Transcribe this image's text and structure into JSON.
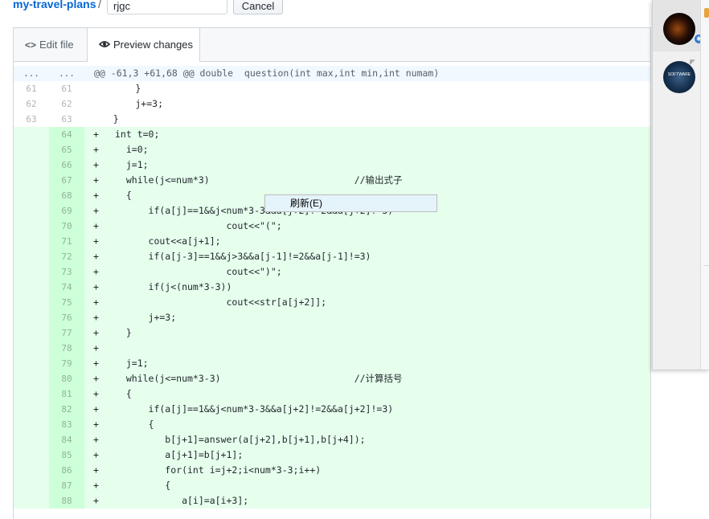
{
  "breadcrumb": {
    "repo": "my-travel-plans",
    "separator": "/",
    "filename": "rjgc",
    "cancel_label": "Cancel"
  },
  "tabs": [
    {
      "label": "Edit file",
      "icon": "code-icon",
      "active": false
    },
    {
      "label": "Preview changes",
      "icon": "eye-icon",
      "active": true
    }
  ],
  "diff": {
    "hunk": {
      "left": "...",
      "right": "...",
      "header": "@@ -61,3 +61,68 @@ double  question(int max,int min,int numam)"
    },
    "context_lines": [
      {
        "old": "61",
        "new": "61",
        "code": "        }"
      },
      {
        "old": "62",
        "new": "62",
        "code": "        j+=3;"
      },
      {
        "old": "63",
        "new": "63",
        "code": "    }"
      }
    ],
    "added_lines": [
      {
        "new": "64",
        "code": "int t=0;"
      },
      {
        "new": "65",
        "code": "  i=0;"
      },
      {
        "new": "66",
        "code": "  j=1;"
      },
      {
        "new": "67",
        "code": "  while(j<=num*3)                          //输出式子"
      },
      {
        "new": "68",
        "code": "  {"
      },
      {
        "new": "69",
        "code": "      if(a[j]==1&&j<num*3-3&&a[j+2]!=2&&a[j+2]!=3)"
      },
      {
        "new": "70",
        "code": "                    cout<<\"(\";"
      },
      {
        "new": "71",
        "code": "      cout<<a[j+1];"
      },
      {
        "new": "72",
        "code": "      if(a[j-3]==1&&j>3&&a[j-1]!=2&&a[j-1]!=3)"
      },
      {
        "new": "73",
        "code": "                    cout<<\")\";"
      },
      {
        "new": "74",
        "code": "      if(j<(num*3-3))"
      },
      {
        "new": "75",
        "code": "                    cout<<str[a[j+2]];"
      },
      {
        "new": "76",
        "code": "      j+=3;"
      },
      {
        "new": "77",
        "code": "  }"
      },
      {
        "new": "78",
        "code": ""
      },
      {
        "new": "79",
        "code": "  j=1;"
      },
      {
        "new": "80",
        "code": "  while(j<=num*3-3)                        //计算括号"
      },
      {
        "new": "81",
        "code": "  {"
      },
      {
        "new": "82",
        "code": "      if(a[j]==1&&j<num*3-3&&a[j+2]!=2&&a[j+2]!=3)"
      },
      {
        "new": "83",
        "code": "      {"
      },
      {
        "new": "84",
        "code": "         b[j+1]=answer(a[j+2],b[j+1],b[j+4]);"
      },
      {
        "new": "85",
        "code": "         a[j+1]=b[j+1];"
      },
      {
        "new": "86",
        "code": "         for(int i=j+2;i<num*3-3;i++)"
      },
      {
        "new": "87",
        "code": "         {"
      },
      {
        "new": "88",
        "code": "            a[i]=a[i+3];"
      }
    ],
    "add_marker": "+"
  },
  "context_menu": {
    "item": "刷新(E)"
  },
  "side_panel": {
    "avatar2_text": "SOFTWARE"
  },
  "colors": {
    "link": "#0366d6",
    "added_bg": "#e6ffed",
    "added_gutter": "#cdffd8",
    "hunk_bg": "#f1f8ff"
  }
}
